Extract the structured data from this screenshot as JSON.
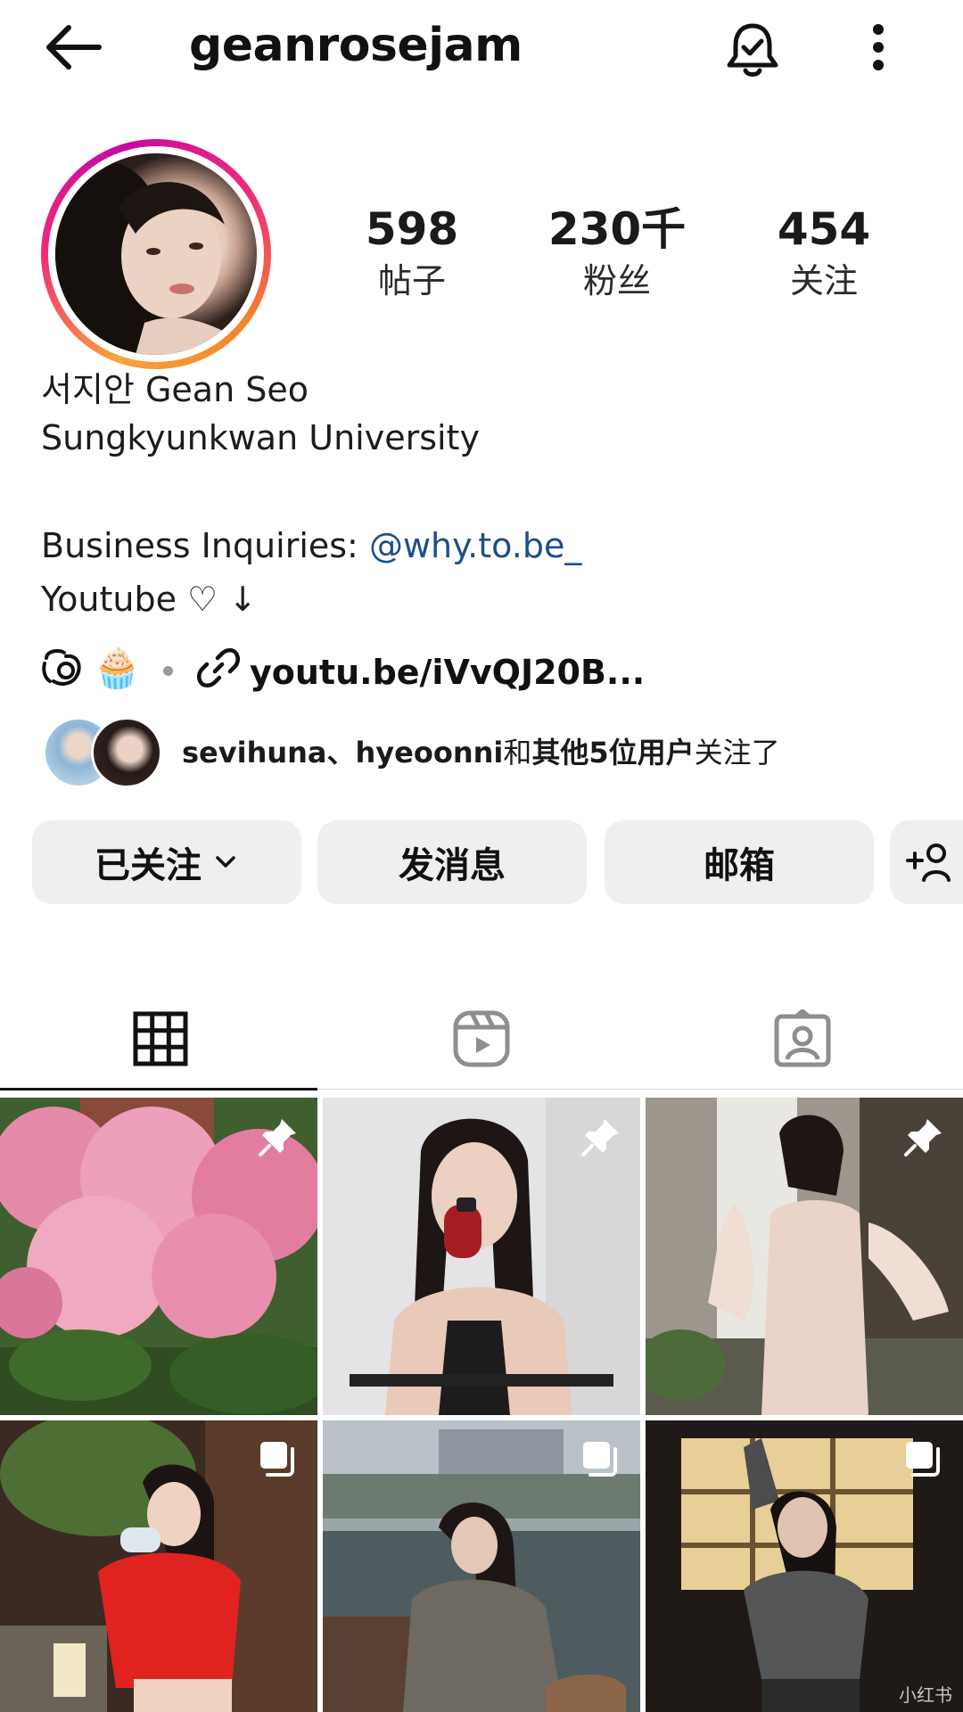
{
  "header": {
    "back_icon": "arrow-left-icon",
    "username": "geanrosejam",
    "bell_icon": "bell-check-icon",
    "more_icon": "more-vertical-icon"
  },
  "profile": {
    "avatar": "profile-photo",
    "story_ring_colors": [
      "#f9a23a",
      "#ee2a7b",
      "#c40aa3"
    ],
    "stats": [
      {
        "value": "598",
        "label": "帖子"
      },
      {
        "value": "230千",
        "label": "粉丝"
      },
      {
        "value": "454",
        "label": "关注"
      }
    ],
    "name": "서지안 Gean Seo",
    "school": "Sungkyunkwan University",
    "bio_business_prefix": "Business Inquiries: ",
    "bio_business_handle": "@why.to.be_",
    "bio_youtube": "Youtube ♡ ↓",
    "threads_icon": "threads-icon",
    "emoji": "🧁",
    "link_icon": "link-icon",
    "link_text": "youtu.be/iVvQJ20B...",
    "link_color": "#1b4f8a"
  },
  "followed_by": {
    "names": "sevihuna、hyeoonni",
    "middle": "和",
    "others": "其他5位用户",
    "suffix": "关注了"
  },
  "actions": {
    "following_label": "已关注",
    "message_label": "发消息",
    "email_label": "邮箱",
    "add_user_icon": "add-user-icon",
    "chevron_icon": "chevron-down-icon"
  },
  "tabs": [
    {
      "icon": "grid-icon",
      "active": true
    },
    {
      "icon": "reels-icon",
      "active": false
    },
    {
      "icon": "tagged-icon",
      "active": false
    }
  ],
  "grid": [
    {
      "scene": "pink roses bush",
      "badge": "pin-icon"
    },
    {
      "scene": "woman holding red bottle",
      "badge": "pin-icon"
    },
    {
      "scene": "woman in pink knit dress",
      "badge": "pin-icon"
    },
    {
      "scene": "woman in red cardigan",
      "badge": "carousel-icon"
    },
    {
      "scene": "woman by the river",
      "badge": "carousel-icon"
    },
    {
      "scene": "woman in grey top",
      "badge": "carousel-icon"
    }
  ],
  "watermark": "小红书"
}
